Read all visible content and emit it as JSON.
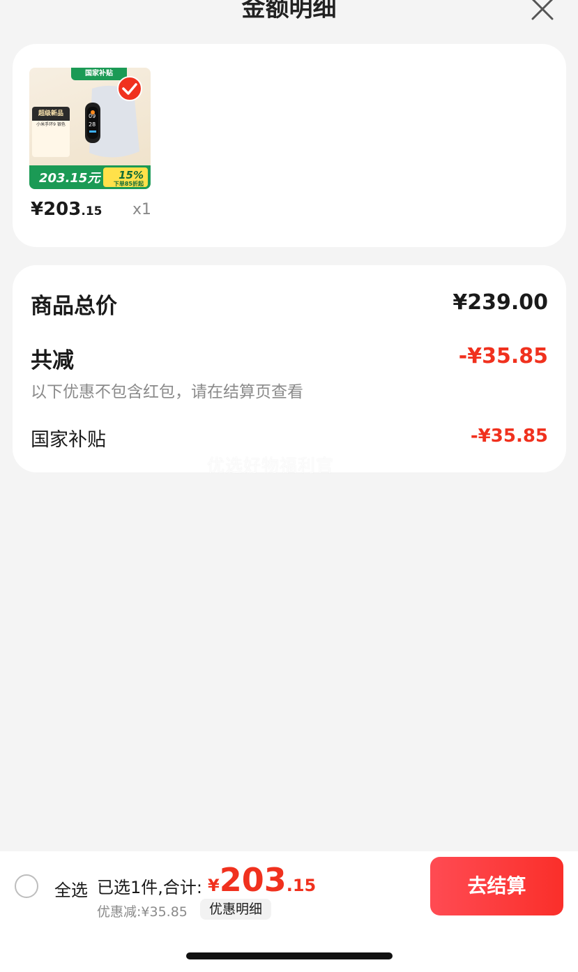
{
  "header": {
    "title": "金额明细"
  },
  "product": {
    "thumb_tag": "国家补贴",
    "thumb_panel_title": "超级新品",
    "thumb_panel_sub": "小米手环9 银色",
    "thumb_price": "203.15元",
    "thumb_pct": "15%",
    "thumb_discount": "下单85折起",
    "price_main": "¥203",
    "price_decimal": ".15",
    "quantity": "x1"
  },
  "summary": {
    "total_label": "商品总价",
    "total_value": "¥239.00",
    "reduce_label": "共减",
    "reduce_value": "-¥35.85",
    "note": "以下优惠不包含红包，请在结算页查看",
    "subsidy_label": "国家补贴",
    "subsidy_value": "-¥35.85"
  },
  "watermark": "优选好物福利官",
  "bottom_bar": {
    "select_all_label": "全选",
    "selected_info": "已选1件,合计:",
    "total_currency": "¥",
    "total_int": "203",
    "total_dec": ".15",
    "discount_note": "优惠减:¥35.85",
    "discount_detail_label": "优惠明细",
    "checkout_label": "去结算"
  },
  "colors": {
    "accent_red": "#f0311e",
    "subsidy_green": "#1b9a55"
  }
}
